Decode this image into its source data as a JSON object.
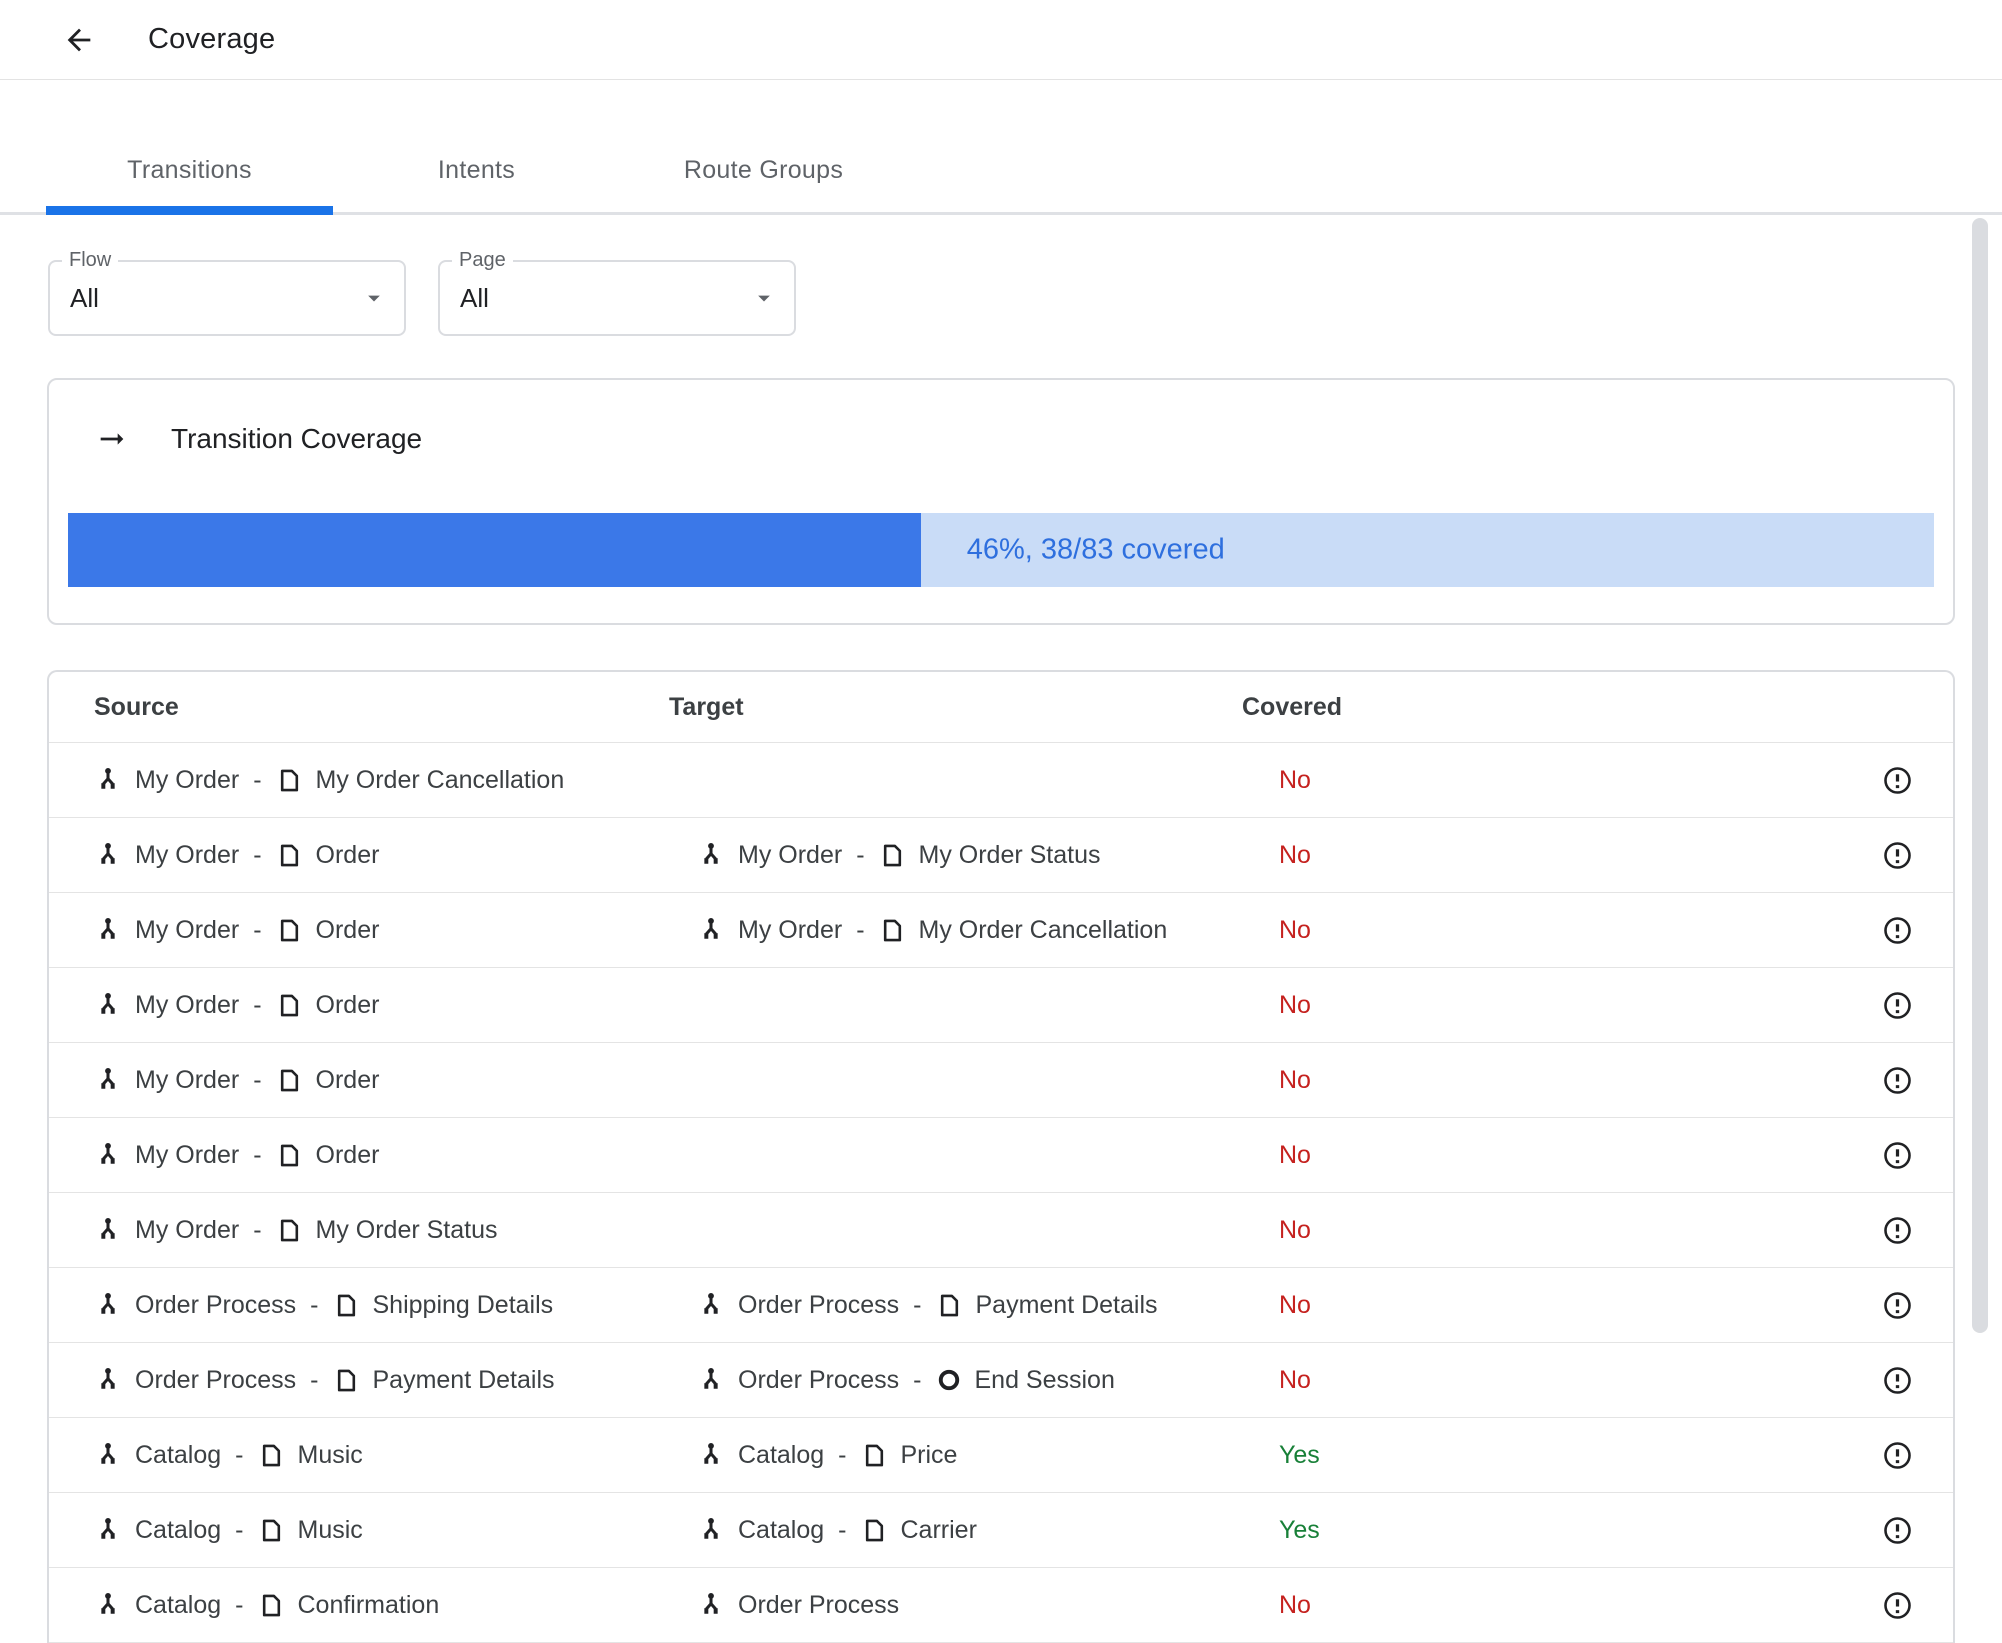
{
  "header": {
    "title": "Coverage",
    "back_icon": "arrow-left"
  },
  "tabs": [
    {
      "label": "Transitions",
      "active": true
    },
    {
      "label": "Intents",
      "active": false
    },
    {
      "label": "Route Groups",
      "active": false
    }
  ],
  "filters": [
    {
      "label": "Flow",
      "value": "All"
    },
    {
      "label": "Page",
      "value": "All"
    }
  ],
  "coverage_card": {
    "icon": "arrow-right",
    "title": "Transition Coverage",
    "progress_percent": 45.7,
    "progress_label": "46%, 38/83 covered",
    "covered_count": 38,
    "total_count": 83
  },
  "table": {
    "columns": [
      "Source",
      "Target",
      "Covered"
    ],
    "rows": [
      {
        "source": {
          "flow": "My Order",
          "node": "My Order Cancellation",
          "node_kind": "page"
        },
        "target": null,
        "covered": "No"
      },
      {
        "source": {
          "flow": "My Order",
          "node": "Order",
          "node_kind": "page"
        },
        "target": {
          "flow": "My Order",
          "node": "My Order Status",
          "node_kind": "page"
        },
        "covered": "No"
      },
      {
        "source": {
          "flow": "My Order",
          "node": "Order",
          "node_kind": "page"
        },
        "target": {
          "flow": "My Order",
          "node": "My Order Cancellation",
          "node_kind": "page"
        },
        "covered": "No"
      },
      {
        "source": {
          "flow": "My Order",
          "node": "Order",
          "node_kind": "page"
        },
        "target": null,
        "covered": "No"
      },
      {
        "source": {
          "flow": "My Order",
          "node": "Order",
          "node_kind": "page"
        },
        "target": null,
        "covered": "No"
      },
      {
        "source": {
          "flow": "My Order",
          "node": "Order",
          "node_kind": "page"
        },
        "target": null,
        "covered": "No"
      },
      {
        "source": {
          "flow": "My Order",
          "node": "My Order Status",
          "node_kind": "page"
        },
        "target": null,
        "covered": "No"
      },
      {
        "source": {
          "flow": "Order Process",
          "node": "Shipping Details",
          "node_kind": "page"
        },
        "target": {
          "flow": "Order Process",
          "node": "Payment Details",
          "node_kind": "page"
        },
        "covered": "No"
      },
      {
        "source": {
          "flow": "Order Process",
          "node": "Payment Details",
          "node_kind": "page"
        },
        "target": {
          "flow": "Order Process",
          "node": "End Session",
          "node_kind": "end-session"
        },
        "covered": "No"
      },
      {
        "source": {
          "flow": "Catalog",
          "node": "Music",
          "node_kind": "page"
        },
        "target": {
          "flow": "Catalog",
          "node": "Price",
          "node_kind": "page"
        },
        "covered": "Yes"
      },
      {
        "source": {
          "flow": "Catalog",
          "node": "Music",
          "node_kind": "page"
        },
        "target": {
          "flow": "Catalog",
          "node": "Carrier",
          "node_kind": "page"
        },
        "covered": "Yes"
      },
      {
        "source": {
          "flow": "Catalog",
          "node": "Confirmation",
          "node_kind": "page"
        },
        "target": {
          "flow": "Order Process",
          "node": null,
          "node_kind": "flow"
        },
        "covered": "No"
      }
    ]
  },
  "icons": {
    "back": "arrow-left-icon",
    "coverage_header": "arrow-right-icon",
    "flow": "flow-icon",
    "page": "page-icon",
    "end_session": "end-session-icon",
    "covered_info": "error-outline-icon",
    "dropdown": "caret-down-icon"
  },
  "colors": {
    "accent_blue": "#1a73e8",
    "progress_fill": "#3b78e8",
    "progress_bg": "#c9dcf7",
    "progress_text": "#2e6fde",
    "covered_yes": "#188038",
    "covered_no": "#c5221f",
    "tab_text": "#5f6368",
    "border": "#dadce0"
  }
}
